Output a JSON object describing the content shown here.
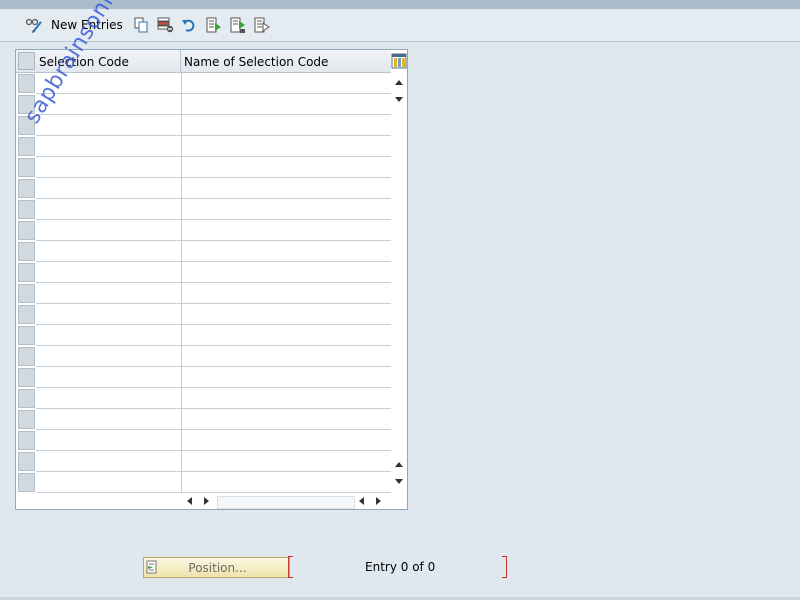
{
  "toolbar": {
    "new_entries_label": "New Entries",
    "icons": [
      "change-glasses-icon",
      "copy-icon",
      "delete-icon",
      "undo-icon",
      "select-all-icon",
      "select-block-icon",
      "deselect-all-icon"
    ]
  },
  "table": {
    "columns": [
      "Selection Code",
      "Name of Selection Code"
    ],
    "rows": [
      [
        "",
        ""
      ],
      [
        "",
        ""
      ],
      [
        "",
        ""
      ],
      [
        "",
        ""
      ],
      [
        "",
        ""
      ],
      [
        "",
        ""
      ],
      [
        "",
        ""
      ],
      [
        "",
        ""
      ],
      [
        "",
        ""
      ],
      [
        "",
        ""
      ],
      [
        "",
        ""
      ],
      [
        "",
        ""
      ],
      [
        "",
        ""
      ],
      [
        "",
        ""
      ],
      [
        "",
        ""
      ],
      [
        "",
        ""
      ],
      [
        "",
        ""
      ],
      [
        "",
        ""
      ],
      [
        "",
        ""
      ],
      [
        "",
        ""
      ]
    ]
  },
  "watermark": "sapbrainsonline.com",
  "footer": {
    "position_label": "Position...",
    "entry_text": "Entry 0 of 0"
  },
  "colors": {
    "background": "#dfe8ef",
    "toolbar": "#e4ecf2",
    "watermark": "#3b5bd6",
    "position_button": "#efe3a9",
    "bracket": "#c0392b"
  }
}
